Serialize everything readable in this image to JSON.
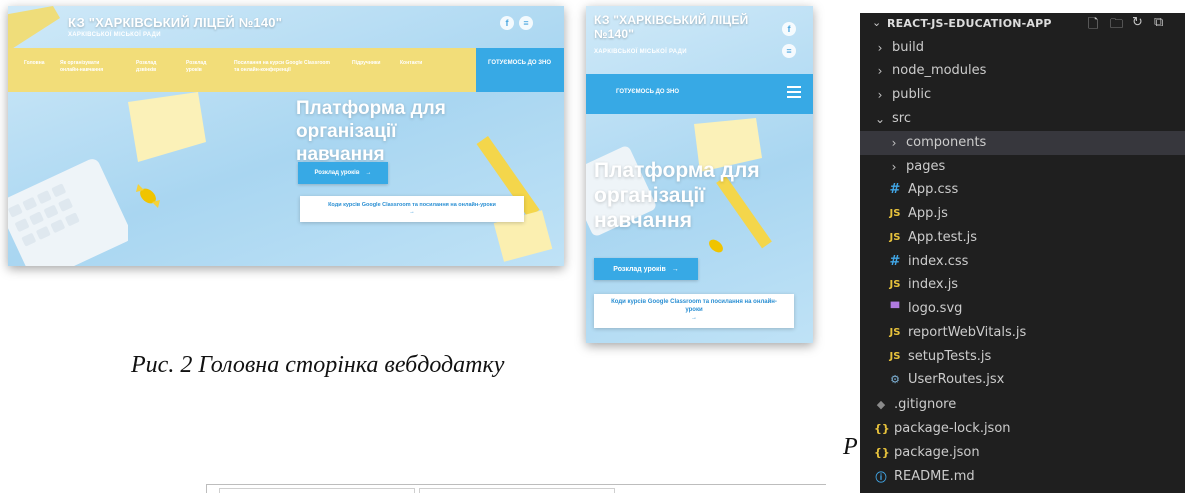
{
  "desktop_site": {
    "title": "КЗ \"ХАРКІВСЬКИЙ ЛІЦЕЙ №140\"",
    "subtitle": "ХАРКІВСЬКОЇ МІСЬКОЇ РАДИ",
    "nav": [
      "Головна",
      "Як організувати онлайн-навчання",
      "Розклад дзвінків",
      "Розклад уроків",
      "Посилання на курси Google Classroom та онлайн-конференції",
      "Підручники",
      "Контакти"
    ],
    "nav_cta": "ГОТУЄМОСЬ ДО ЗНО",
    "hero_title": "Платформа для організації навчання",
    "schedule_button": "Розклад уроків",
    "classroom_button": "Коди курсів Google Classroom та посилання на онлайн-уроки",
    "arrow": "→"
  },
  "mobile_site": {
    "title": "КЗ \"ХАРКІВСЬКИЙ ЛІЦЕЙ №140\"",
    "subtitle": "ХАРКІВСЬКОЇ МІСЬКОЇ РАДИ",
    "nav_cta": "ГОТУЄМОСЬ ДО ЗНО",
    "hero_title": "Платформа для організації навчання",
    "schedule_button": "Розклад уроків",
    "classroom_button": "Коди курсів Google Classroom та посилання на онлайн-уроки",
    "arrow": "→"
  },
  "caption": "Рис. 2  Головна сторінка вебдодатку",
  "caption_partial": "Р",
  "explorer": {
    "project": "REACT-JS-EDUCATION-APP",
    "items": [
      {
        "label": "build",
        "type": "folder",
        "expanded": false
      },
      {
        "label": "node_modules",
        "type": "folder",
        "expanded": false
      },
      {
        "label": "public",
        "type": "folder",
        "expanded": false
      },
      {
        "label": "src",
        "type": "folder",
        "expanded": true
      },
      {
        "label": "components",
        "type": "folder",
        "expanded": false
      },
      {
        "label": "pages",
        "type": "folder",
        "expanded": false
      },
      {
        "label": "App.css",
        "type": "css"
      },
      {
        "label": "App.js",
        "type": "js"
      },
      {
        "label": "App.test.js",
        "type": "js"
      },
      {
        "label": "index.css",
        "type": "css"
      },
      {
        "label": "index.js",
        "type": "js"
      },
      {
        "label": "logo.svg",
        "type": "svg"
      },
      {
        "label": "reportWebVitals.js",
        "type": "js"
      },
      {
        "label": "setupTests.js",
        "type": "js"
      },
      {
        "label": "UserRoutes.jsx",
        "type": "jsx"
      },
      {
        "label": ".gitignore",
        "type": "git"
      },
      {
        "label": "package-lock.json",
        "type": "json"
      },
      {
        "label": "package.json",
        "type": "json"
      },
      {
        "label": "README.md",
        "type": "md"
      }
    ],
    "icons": {
      "folder_collapsed": "›",
      "folder_expanded": "⌄",
      "js": "JS",
      "css": "#",
      "json": "{}",
      "svg": "▀",
      "jsx": "⚙",
      "git": "◆",
      "md": "ⓘ"
    }
  }
}
